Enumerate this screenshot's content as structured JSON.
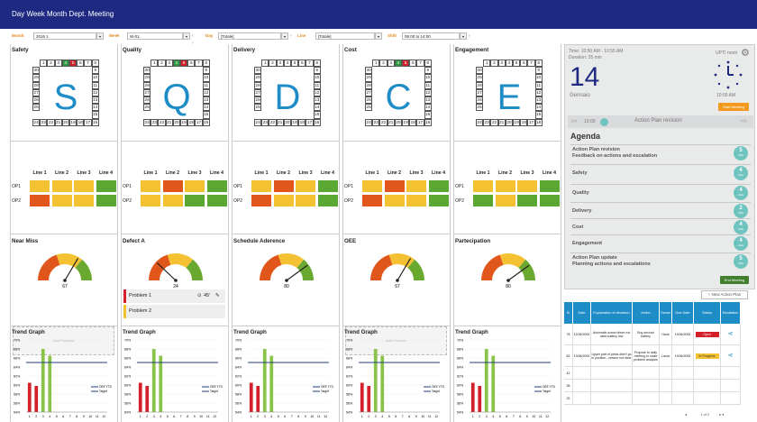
{
  "header": {
    "title": "Day Week Month Dept. Meeting"
  },
  "filters": {
    "month_label": "Month",
    "month_value": "2016 1",
    "week_label": "Week",
    "week_value": "W-01",
    "day_label": "Day",
    "day_value": "[Totale]",
    "line_label": "Line",
    "line_value": "[Totale]",
    "shift_label": "Shift",
    "shift_value": "06:00 to 14:00"
  },
  "columns": [
    {
      "title": "Safety",
      "letter": "S",
      "marked": [
        4,
        5
      ],
      "grid": [
        [
          "#f4c133",
          "#f4c133",
          "#f4c133",
          "#5aa832"
        ],
        [
          "#e0561b",
          "#f4c133",
          "#f4c133",
          "#5aa832"
        ]
      ],
      "kpi_title": "Near Miss",
      "gauge_value": "67",
      "gauge_pct": 0.67,
      "trend_title": "Trend Graph",
      "has_problems": false,
      "add_label": "Add Problem"
    },
    {
      "title": "Quality",
      "letter": "Q",
      "marked": [
        4,
        5
      ],
      "grid": [
        [
          "#f4c133",
          "#e0561b",
          "#f4c133",
          "#5aa832"
        ],
        [
          "#f4c133",
          "#f4c133",
          "#5aa832",
          "#5aa832"
        ]
      ],
      "kpi_title": "Defect A",
      "gauge_value": "24",
      "gauge_pct": 0.24,
      "trend_title": "Trend Graph",
      "has_problems": true,
      "problems": [
        {
          "text": "Problem 1",
          "color": "#d3202a",
          "time": "45'"
        },
        {
          "text": "Problem 2",
          "color": "#f4c133",
          "time": ""
        }
      ]
    },
    {
      "title": "Delivery",
      "letter": "D",
      "marked": [],
      "grid": [
        [
          "#f4c133",
          "#e0561b",
          "#f4c133",
          "#5aa832"
        ],
        [
          "#e0561b",
          "#f4c133",
          "#f4c133",
          "#5aa832"
        ]
      ],
      "kpi_title": "Schedule Aderence",
      "gauge_value": "80",
      "gauge_pct": 0.8,
      "trend_title": "Trend Graph",
      "has_problems": false,
      "add_label": ""
    },
    {
      "title": "Cost",
      "letter": "C",
      "marked": [
        4,
        5
      ],
      "grid": [
        [
          "#f4c133",
          "#e0561b",
          "#f4c133",
          "#5aa832"
        ],
        [
          "#e0561b",
          "#f4c133",
          "#f4c133",
          "#5aa832"
        ]
      ],
      "kpi_title": "OEE",
      "gauge_value": "67",
      "gauge_pct": 0.67,
      "trend_title": "Trend Graph",
      "has_problems": false,
      "add_label": "Add Problem"
    },
    {
      "title": "Engagement",
      "letter": "E",
      "marked": [],
      "grid": [
        [
          "#f4c133",
          "#f4c133",
          "#f4c133",
          "#5aa832"
        ],
        [
          "#5aa832",
          "#f4c133",
          "#5aa832",
          "#5aa832"
        ]
      ],
      "kpi_title": "Partecipation",
      "gauge_value": "80",
      "gauge_pct": 0.8,
      "trend_title": "Trend Graph",
      "has_problems": false,
      "add_label": ""
    }
  ],
  "grid_headers": [
    "Line 1",
    "Line 2",
    "Line 3",
    "Line 4"
  ],
  "grid_rows": [
    "OP1",
    "OP2"
  ],
  "trend": {
    "y_ticks": [
      "70%",
      "68%",
      "66%",
      "64%",
      "62%",
      "60%",
      "58%",
      "56%",
      "54%"
    ],
    "x_ticks": [
      "1",
      "2",
      "3",
      "4",
      "5",
      "6",
      "7",
      "8",
      "9",
      "10",
      "11",
      "12"
    ],
    "legend": [
      "OEE YTD",
      "Target"
    ]
  },
  "chart_data": {
    "type": "bar",
    "categories": [
      "1",
      "2",
      "3",
      "4",
      "5",
      "6",
      "7",
      "8",
      "9",
      "10",
      "11",
      "12"
    ],
    "series": [
      {
        "name": "OEE YTD",
        "values": [
          60.5,
          59.8,
          null,
          null,
          null,
          null,
          null,
          null,
          null,
          null,
          null,
          null
        ],
        "color": "#d3202a"
      },
      {
        "name": "OEE YTD",
        "values": [
          null,
          null,
          68,
          66.5,
          null,
          null,
          null,
          null,
          null,
          null,
          null,
          null
        ],
        "color": "#8bc34a"
      },
      {
        "name": "Target",
        "values": [
          65,
          65,
          65,
          65,
          65,
          65,
          65,
          65,
          65,
          65,
          65,
          65
        ],
        "color": "#1e3c7a"
      }
    ],
    "ylim": [
      54,
      70
    ]
  },
  "panel": {
    "time": "Time: 10:50 AM - 10:55 AM",
    "duration": "Duration: 35 min",
    "room": "UPTI room",
    "day": "14",
    "month": "Gennaio",
    "clock_time": "10:00 AM",
    "start_btn": "Start Meeting",
    "prev_time": "10:00",
    "current_step": "Action Plan revision",
    "agenda_title": "Agenda",
    "agenda": [
      {
        "line1": "Action Plan revision",
        "line2": "Feedback on actions and escalation",
        "num": "5",
        "unit": "min"
      },
      {
        "line1": "Safety",
        "line2": "",
        "num": "4",
        "unit": "min"
      },
      {
        "line1": "Quality",
        "line2": "",
        "num": "4",
        "unit": "min"
      },
      {
        "line1": "Delivery",
        "line2": "",
        "num": "2",
        "unit": "min"
      },
      {
        "line1": "Cost",
        "line2": "",
        "num": "4",
        "unit": "min"
      },
      {
        "line1": "Engagement",
        "line2": "",
        "num": "4",
        "unit": "min"
      },
      {
        "line1": "Action Plan update",
        "line2": "Planning actions and escalations",
        "num": "5",
        "unit": "min"
      }
    ],
    "end_btn": "End Meeting"
  },
  "actions": {
    "new_label": "New Action Plan",
    "headers": [
      "ID",
      "Date",
      "Explanation of deviation",
      "Action",
      "Owner",
      "Due Date",
      "Status",
      "Escalation"
    ],
    "rows": [
      {
        "id": "78",
        "date": "12/06/2009",
        "expl": "Automatic screw driver not used battery low",
        "action": "Buy second battery",
        "owner": "Hank",
        "due": "19/06/2009",
        "status": "Open",
        "status_color": "#d3202a"
      },
      {
        "id": "82",
        "date": "13/06/2009",
        "expl": "Upper part of press didn't go in position - reason not clear",
        "action": "Propose to daily meeting to make problem analysis",
        "owner": "Laura",
        "due": "19/06/2009",
        "status": "In Progress",
        "status_color": "#f4c133"
      },
      {
        "id": "42",
        "date": "",
        "expl": "",
        "action": "",
        "owner": "",
        "due": "",
        "status": "",
        "status_color": ""
      },
      {
        "id": "38",
        "date": "",
        "expl": "",
        "action": "",
        "owner": "",
        "due": "",
        "status": "",
        "status_color": ""
      },
      {
        "id": "25",
        "date": "",
        "expl": "",
        "action": "",
        "owner": "",
        "due": "",
        "status": "",
        "status_color": ""
      }
    ],
    "page": "1 of 2"
  }
}
